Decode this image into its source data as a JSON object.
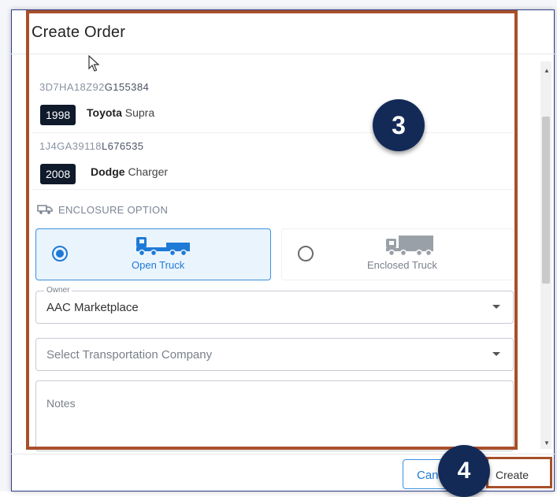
{
  "modal": {
    "title": "Create Order"
  },
  "vehicles": [
    {
      "vin_prefix": "3D7HA18Z92",
      "vin_suffix": "G155384",
      "year": "1998",
      "make": "Toyota",
      "model": "Supra"
    },
    {
      "vin_prefix": "1J4GA39118",
      "vin_suffix": "L676535",
      "year": "2008",
      "make": "Dodge",
      "model": "Charger"
    }
  ],
  "enclosure": {
    "label": "ENCLOSURE OPTION",
    "options": [
      {
        "label": "Open Truck",
        "selected": true
      },
      {
        "label": "Enclosed Truck",
        "selected": false
      }
    ]
  },
  "owner": {
    "legend": "Owner",
    "value": "AAC Marketplace"
  },
  "transport": {
    "placeholder": "Select Transportation Company"
  },
  "notes": {
    "placeholder": "Notes"
  },
  "footer": {
    "cancel_label": "Can",
    "create_label": "Create"
  },
  "callouts": {
    "step3": "3",
    "step4": "4"
  },
  "colors": {
    "accent": "#1e7ad6",
    "highlight": "#a8502a",
    "callout": "#132a57",
    "badge": "#0f1a2b"
  }
}
